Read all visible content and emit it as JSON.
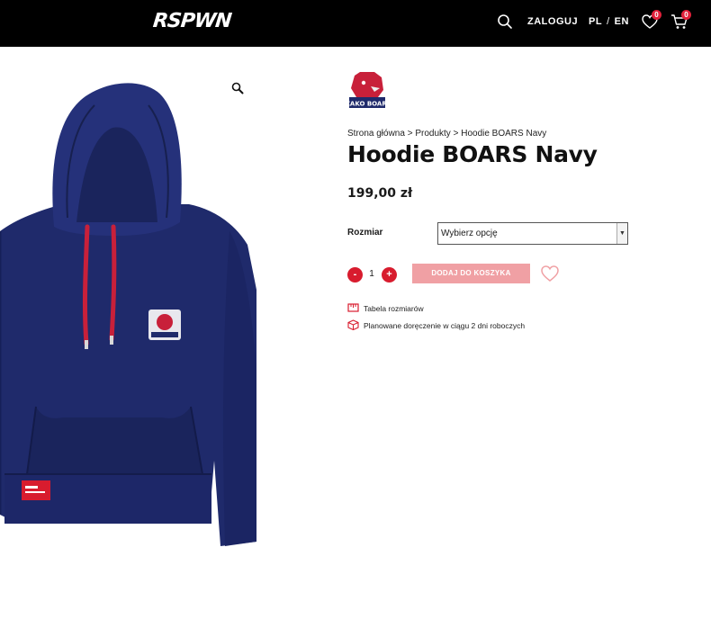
{
  "header": {
    "logo_text": "RSPWN",
    "login_label": "ZALOGUJ",
    "lang_pl": "PL",
    "lang_sep": "/",
    "lang_en": "EN",
    "wishlist_count": "0",
    "cart_count": "0"
  },
  "product": {
    "breadcrumb": {
      "home": "Strona główna",
      "sep1": " > ",
      "products": "Produkty",
      "sep2": " > ",
      "current": "Hoodie BOARS Navy"
    },
    "title": "Hoodie BOARS Navy",
    "price": "199,00 zł",
    "size_label": "Rozmiar",
    "size_select_value": "Wybierz opcję",
    "quantity": "1",
    "minus_label": "-",
    "plus_label": "+",
    "add_to_cart_label": "DODAJ DO KOSZYKA",
    "size_table_label": "Tabela rozmiarów",
    "delivery_label": "Planowane doręczenie w ciągu 2 dni roboczych",
    "brand_logo_text": "IZAKO BOARS"
  },
  "colors": {
    "accent": "#d81c2e",
    "add_to_cart_disabled": "#f0a0a4",
    "hoodie_navy": "#1f2a6b",
    "drawstring_red": "#c8203a"
  },
  "icons": [
    "search-icon",
    "heart-icon",
    "cart-icon",
    "zoom-icon",
    "ruler-icon",
    "box-icon"
  ]
}
